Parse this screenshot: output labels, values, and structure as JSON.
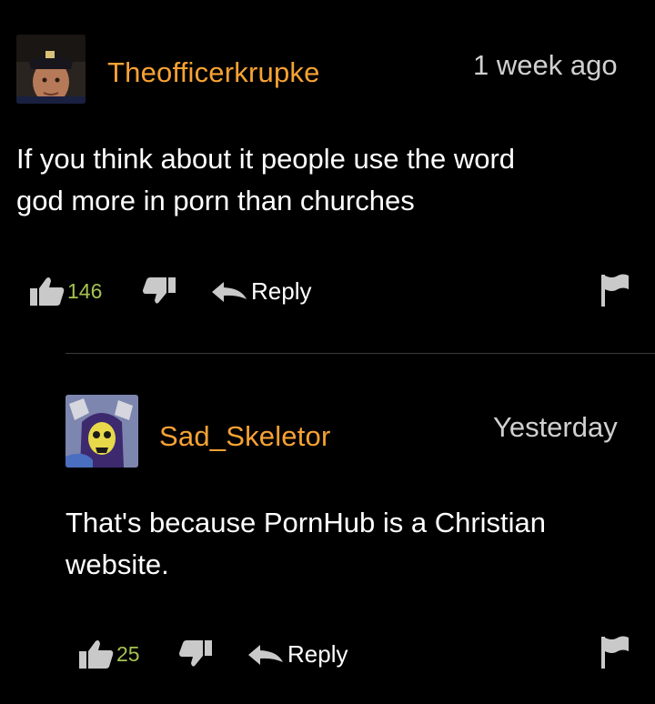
{
  "colors": {
    "background": "#000000",
    "username": "#f7a234",
    "vote_count": "#a4c251",
    "text": "#ffffff",
    "timestamp": "#d0d0d0",
    "icon": "#c9c9c9"
  },
  "comments": [
    {
      "username": "Theofficerkrupke",
      "timestamp": "1 week ago",
      "body_lines": [
        "If you think about it people use the word",
        "god more in porn than churches"
      ],
      "upvotes": "146",
      "reply_label": "Reply",
      "icons": [
        "thumbs-up-icon",
        "thumbs-down-icon",
        "reply-arrow-icon",
        "flag-icon"
      ]
    },
    {
      "username": "Sad_Skeletor",
      "timestamp": "Yesterday",
      "body_lines": [
        "That's because PornHub is a Christian",
        "website."
      ],
      "upvotes": "25",
      "reply_label": "Reply",
      "icons": [
        "thumbs-up-icon",
        "thumbs-down-icon",
        "reply-arrow-icon",
        "flag-icon"
      ]
    }
  ]
}
